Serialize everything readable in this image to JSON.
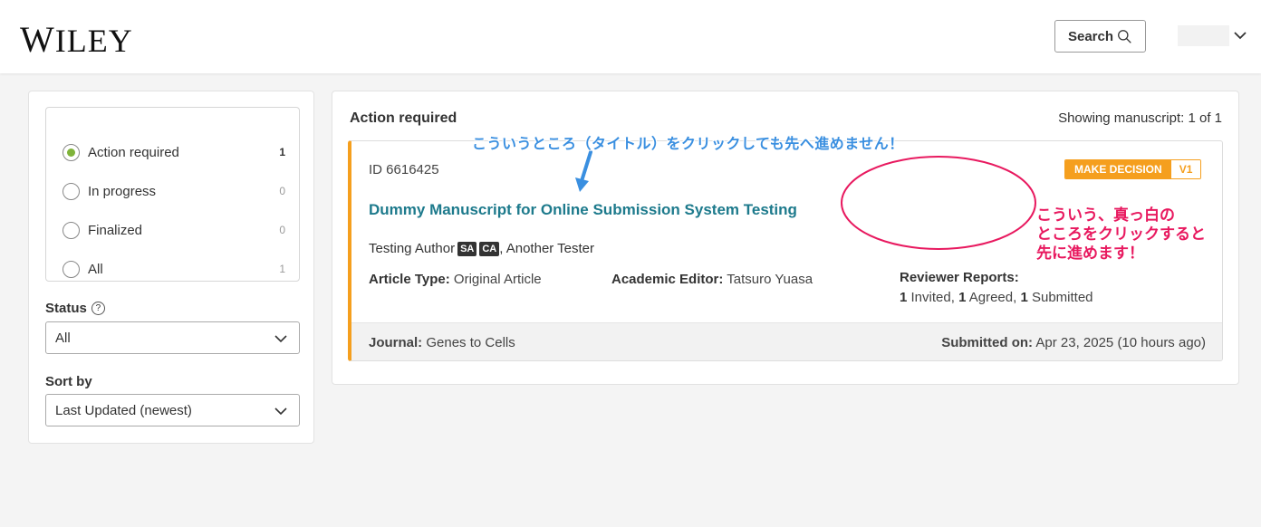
{
  "header": {
    "logo_first": "W",
    "logo_rest": "ILEY",
    "search_label": "Search"
  },
  "sidebar": {
    "filters": [
      {
        "label": "Action required",
        "count": "1"
      },
      {
        "label": "In progress",
        "count": "0"
      },
      {
        "label": "Finalized",
        "count": "0"
      },
      {
        "label": "All",
        "count": "1"
      }
    ],
    "status_label": "Status",
    "status_value": "All",
    "sort_label": "Sort by",
    "sort_value": "Last Updated (newest)"
  },
  "main": {
    "section_title": "Action required",
    "showing": "Showing manuscript: 1 of 1",
    "manuscript": {
      "id": "ID 6616425",
      "title": "Dummy Manuscript for Online Submission System Testing",
      "badge": "MAKE DECISION",
      "version": "V1",
      "author1": "Testing Author",
      "role1": "SA",
      "role2": "CA",
      "author2": ", Another Tester",
      "article_type_label": "Article Type:",
      "article_type": "Original Article",
      "editor_label": "Academic Editor:",
      "editor": "Tatsuro Yuasa",
      "reviewer_label": "Reviewer Reports:",
      "invited_n": "1",
      "invited": "Invited,",
      "agreed_n": "1",
      "agreed": "Agreed,",
      "submitted_n": "1",
      "submitted": "Submitted",
      "journal_label": "Journal:",
      "journal": "Genes to Cells",
      "submitted_on_label": "Submitted on:",
      "submitted_on": "Apr 23, 2025 (10 hours ago)"
    }
  },
  "annotations": {
    "blue_note": "こういうところ（タイトル）をクリックしても先へ進めません！",
    "pink_line1": "こういう、真っ白の",
    "pink_line2": "ところをクリックすると",
    "pink_line3": "先に進めます！",
    "blue_color": "#3a8fe0",
    "pink_color": "#e8195f"
  },
  "colors": {
    "accent_orange": "#f59f1e",
    "title_teal": "#1d7a8c",
    "radio_green": "#7fb33a"
  }
}
